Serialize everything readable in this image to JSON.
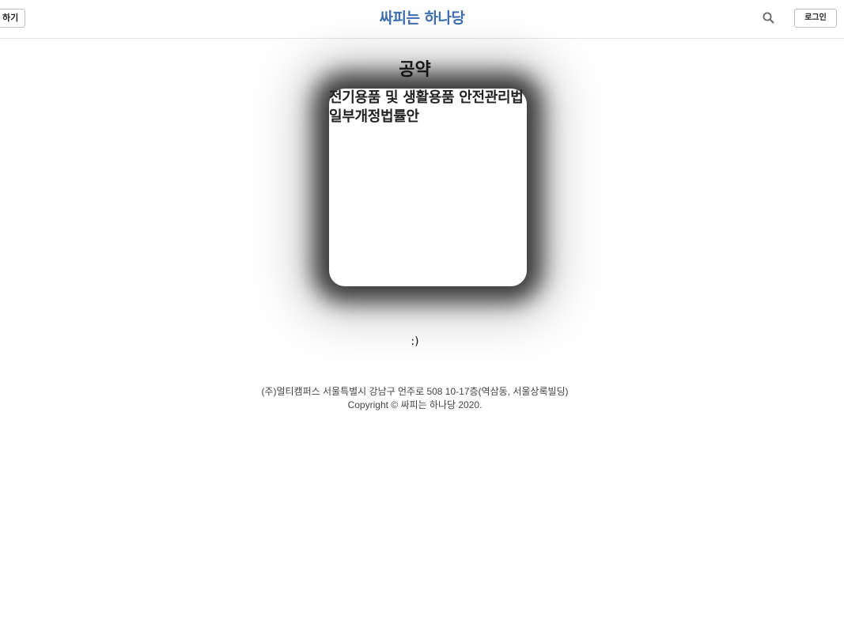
{
  "header": {
    "left_button_label": "하기",
    "brand": "싸피는 하나당",
    "search_icon": "search-icon",
    "login_label": "로그인"
  },
  "main": {
    "section_title": "공약",
    "card": {
      "title": "전기용품 및 생활용품 안전관리법 일부개정법률안"
    },
    "smiley": ":)"
  },
  "footer": {
    "address": "(주)멀티캠퍼스 서울특별시 강남구 언주로 508 10-17층(역삼동, 서울상록빌딩)",
    "copyright": "Copyright © 싸피는 하나당 2020."
  },
  "colors": {
    "brand": "#3f6fb0",
    "divider": "#e6e6e6"
  }
}
